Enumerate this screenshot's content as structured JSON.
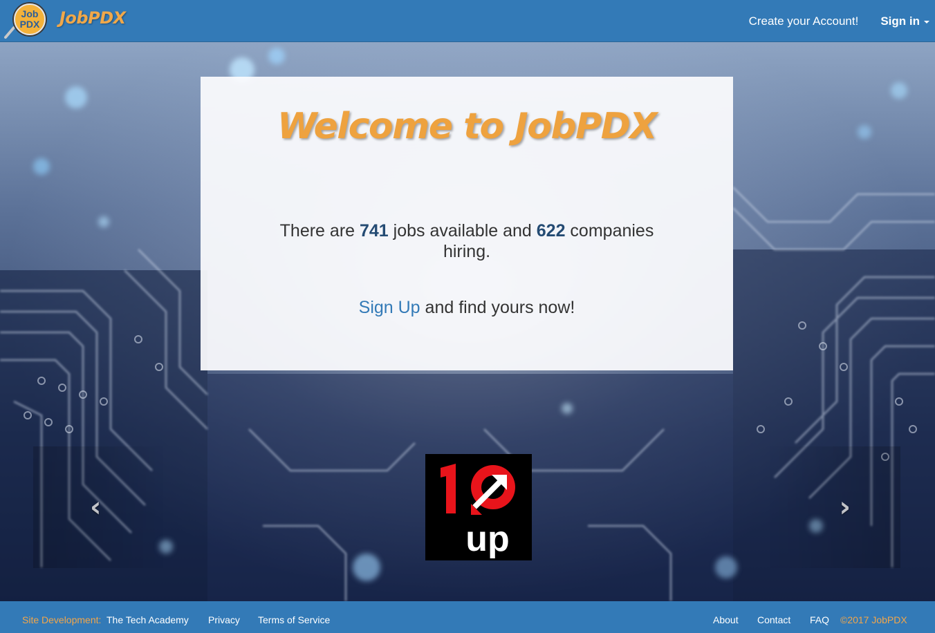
{
  "navbar": {
    "logo_text_top": "Job",
    "logo_text_bottom": "PDX",
    "brand": "JobPDX",
    "create_account": "Create your Account!",
    "sign_in": "Sign in"
  },
  "welcome": {
    "title": "Welcome to JobPDX",
    "stats_prefix": "There are ",
    "jobs_count": "741",
    "stats_middle": " jobs available and ",
    "companies_count": "622",
    "stats_suffix": " companies hiring.",
    "signup_link": "Sign Up",
    "cta_suffix": " and find yours now!"
  },
  "carousel": {
    "prev_icon": "chevron-left-icon",
    "next_icon": "chevron-right-icon",
    "logo_text_top": "10",
    "logo_text_bottom": "up"
  },
  "footer": {
    "site_dev_label": "Site Development:",
    "tech_academy": "The Tech Academy",
    "privacy": "Privacy",
    "terms": "Terms of Service",
    "about": "About",
    "contact": "Contact",
    "faq": "FAQ",
    "copyright": "©2017 JobPDX"
  },
  "colors": {
    "navbar": "#337ab7",
    "brand_orange": "#eea23f",
    "link_blue": "#337ab7"
  }
}
